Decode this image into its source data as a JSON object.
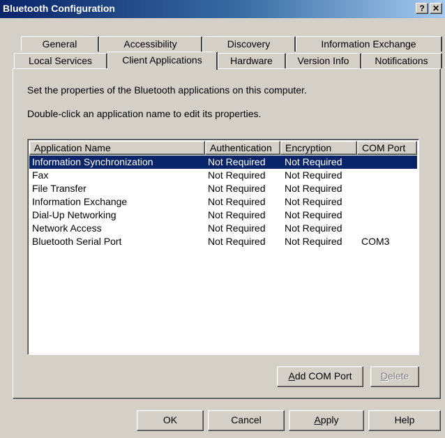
{
  "window": {
    "title": "Bluetooth Configuration",
    "help_glyph": "?",
    "close_glyph": "✕"
  },
  "tabs": {
    "row1": [
      "General",
      "Accessibility",
      "Discovery",
      "Information Exchange"
    ],
    "row2": [
      "Local Services",
      "Client Applications",
      "Hardware",
      "Version Info",
      "Notifications"
    ],
    "active": "Client Applications"
  },
  "panel": {
    "description": "Set the properties of the Bluetooth applications on this computer.",
    "instruction": "Double-click an application name to edit its properties."
  },
  "list": {
    "columns": [
      "Application Name",
      "Authentication",
      "Encryption",
      "COM Port"
    ],
    "rows": [
      [
        "Information Synchronization",
        "Not Required",
        "Not Required",
        ""
      ],
      [
        "Fax",
        "Not Required",
        "Not Required",
        ""
      ],
      [
        "File Transfer",
        "Not Required",
        "Not Required",
        ""
      ],
      [
        "Information Exchange",
        "Not Required",
        "Not Required",
        ""
      ],
      [
        "Dial-Up Networking",
        "Not Required",
        "Not Required",
        ""
      ],
      [
        "Network Access",
        "Not Required",
        "Not Required",
        ""
      ],
      [
        "Bluetooth Serial Port",
        "Not Required",
        "Not Required",
        "COM3"
      ]
    ],
    "selected_row": "Information Synchronization"
  },
  "panel_buttons": {
    "add_com_port": {
      "accel": "A",
      "rest": "dd COM Port"
    },
    "delete": {
      "accel": "D",
      "rest": "elete"
    }
  },
  "dialog_buttons": {
    "ok": "OK",
    "cancel": "Cancel",
    "apply": {
      "accel": "A",
      "rest": "pply"
    },
    "help": "Help"
  },
  "colors": {
    "selection": "#0a246a",
    "face": "#d4d0c8",
    "title_start": "#0a246a",
    "title_end": "#a6caf0"
  }
}
